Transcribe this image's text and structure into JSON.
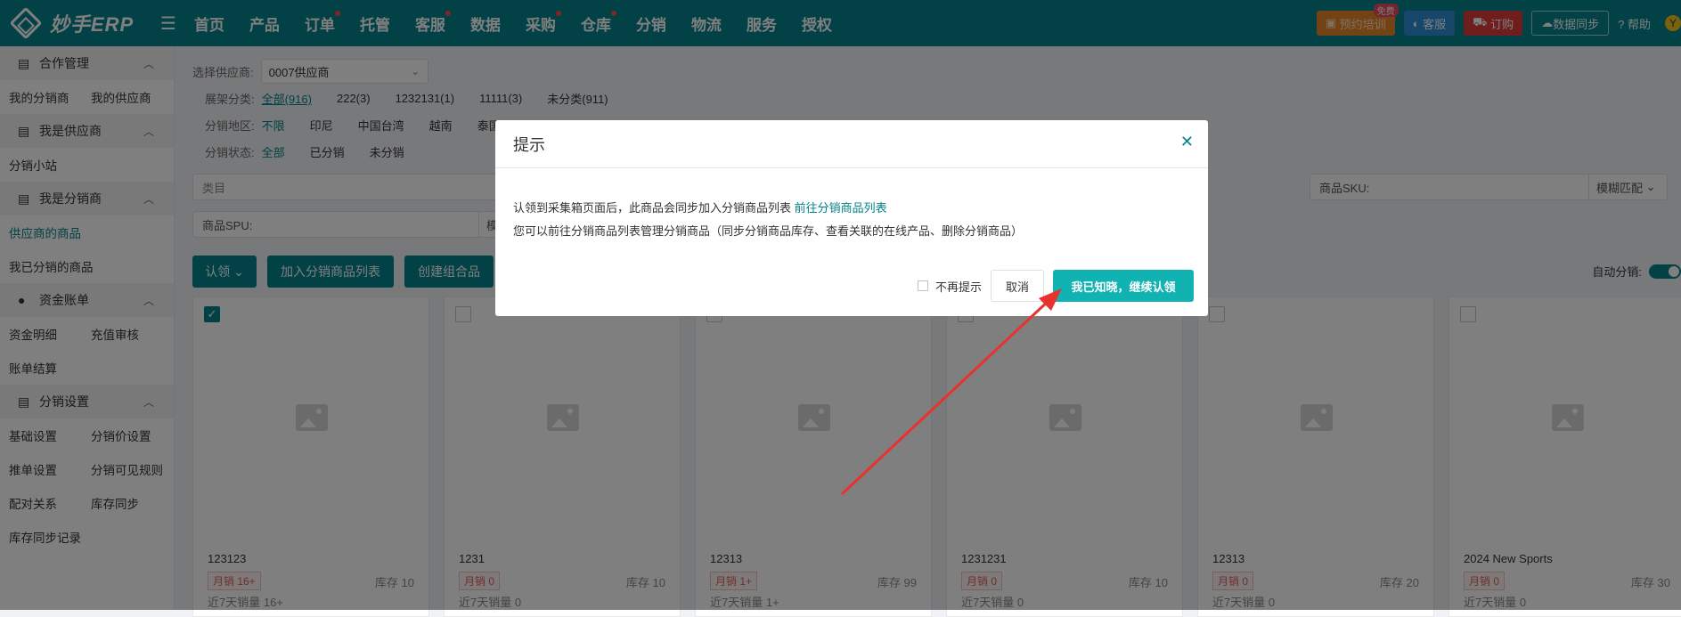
{
  "nav": {
    "logo_text": "妙手ERP",
    "items": [
      {
        "label": "首页",
        "dot": false
      },
      {
        "label": "产品",
        "dot": false
      },
      {
        "label": "订单",
        "dot": true
      },
      {
        "label": "托管",
        "dot": false
      },
      {
        "label": "客服",
        "dot": true
      },
      {
        "label": "数据",
        "dot": false
      },
      {
        "label": "采购",
        "dot": true
      },
      {
        "label": "仓库",
        "dot": true
      },
      {
        "label": "分销",
        "dot": false
      },
      {
        "label": "物流",
        "dot": false
      },
      {
        "label": "服务",
        "dot": false
      },
      {
        "label": "授权",
        "dot": false
      }
    ],
    "training": "预约培训",
    "free_badge": "免费",
    "customer_service": "客服",
    "order": "订购",
    "data_sync": "数据同步",
    "help": "帮助",
    "avatar_initial": "Y"
  },
  "sidebar": {
    "groups": [
      {
        "title": "合作管理",
        "items": [
          [
            "我的分销商",
            "我的供应商"
          ]
        ]
      },
      {
        "title": "我是供应商",
        "items": [
          [
            "分销小站"
          ]
        ]
      },
      {
        "title": "我是分销商",
        "items": [
          [
            "供应商的商品"
          ],
          [
            "我已分销的商品"
          ]
        ]
      },
      {
        "title": "资金账单",
        "items": [
          [
            "资金明细",
            "充值审核"
          ],
          [
            "账单结算"
          ]
        ]
      },
      {
        "title": "分销设置",
        "items": [
          [
            "基础设置",
            "分销价设置"
          ],
          [
            "推单设置",
            "分销可见规则"
          ],
          [
            "配对关系",
            "库存同步"
          ],
          [
            "库存同步记录"
          ]
        ]
      }
    ],
    "active_item": "供应商的商品"
  },
  "filters": {
    "supplier_label": "选择供应商:",
    "supplier_value": "0007供应商",
    "shelf_label": "展架分类:",
    "shelf_tags": [
      "全部(916)",
      "222(3)",
      "1232131(1)",
      "11111(3)",
      "未分类(911)"
    ],
    "region_label": "分销地区:",
    "region_tags": [
      "不限",
      "印尼",
      "中国台湾",
      "越南",
      "泰国"
    ],
    "status_label": "分销状态:",
    "status_tags": [
      "全部",
      "已分销",
      "未分销"
    ],
    "category_placeholder": "类目",
    "sku_label": "商品SKU:",
    "sku_match": "模糊匹配",
    "spu_label": "商品SPU:",
    "spu_match": "模"
  },
  "actions": {
    "claim": "认领",
    "add_to_list": "加入分销商品列表",
    "create_combo": "创建组合品",
    "auto_distribute": "自动分销:"
  },
  "products": [
    {
      "name": "123123",
      "sales": "月销 16+",
      "stock": "库存 10",
      "sales7": "近7天销量 16+",
      "checked": true
    },
    {
      "name": "1231",
      "sales": "月销 0",
      "stock": "库存 10",
      "sales7": "近7天销量 0",
      "checked": false
    },
    {
      "name": "12313",
      "sales": "月销 1+",
      "stock": "库存 99",
      "sales7": "近7天销量 1+",
      "checked": false
    },
    {
      "name": "1231231",
      "sales": "月销 0",
      "stock": "库存 10",
      "sales7": "近7天销量 0",
      "checked": false
    },
    {
      "name": "12313",
      "sales": "月销 0",
      "stock": "库存 20",
      "sales7": "近7天销量 0",
      "checked": false
    },
    {
      "name": "2024 New Sports",
      "sales": "月销 0",
      "stock": "库存 30",
      "sales7": "近7天销量 0",
      "checked": false
    }
  ],
  "dialog": {
    "title": "提示",
    "line1": "认领到采集箱页面后，此商品会同步加入分销商品列表",
    "link": "前往分销商品列表",
    "line2": "您可以前往分销商品列表管理分销商品（同步分销商品库存、查看关联的在线产品、删除分销商品）",
    "dont_show": "不再提示",
    "cancel": "取消",
    "confirm": "我已知晓，继续认领"
  },
  "colors": {
    "primary": "#04828b",
    "confirm": "#10b2b2",
    "arrow": "#e8322e"
  }
}
